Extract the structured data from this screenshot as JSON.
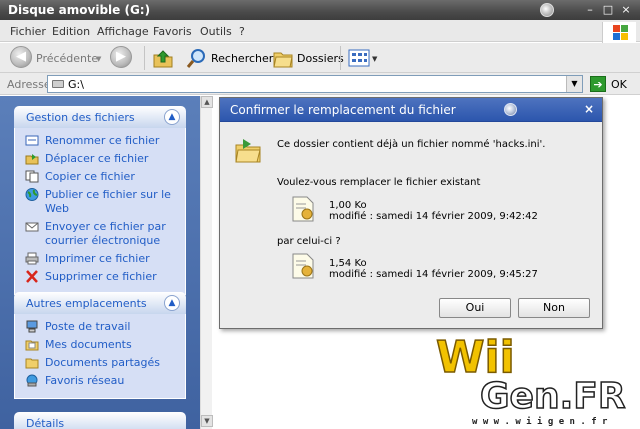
{
  "window": {
    "title": "Disque amovible (G:)"
  },
  "menu": [
    "Fichier",
    "Edition",
    "Affichage",
    "Favoris",
    "Outils",
    "?"
  ],
  "toolbar": {
    "back_label": "Précédente",
    "search_label": "Rechercher",
    "folders_label": "Dossiers"
  },
  "address": {
    "label": "Adresse",
    "value": "G:\\",
    "go_label": "OK"
  },
  "panels": {
    "file_tasks": {
      "title": "Gestion des fichiers",
      "items": [
        "Renommer ce fichier",
        "Déplacer ce fichier",
        "Copier ce fichier",
        "Publier ce fichier sur le Web",
        "Envoyer ce fichier par courrier électronique",
        "Imprimer ce fichier",
        "Supprimer ce fichier"
      ]
    },
    "other_places": {
      "title": "Autres emplacements",
      "items": [
        "Poste de travail",
        "Mes documents",
        "Documents partagés",
        "Favoris réseau"
      ]
    },
    "details": {
      "title": "Détails"
    }
  },
  "dialog": {
    "title": "Confirmer le remplacement du fichier",
    "message": "Ce dossier contient déjà un fichier nommé 'hacks.ini'.",
    "question": "Voulez-vous remplacer le fichier existant",
    "existing": {
      "size": "1,00 Ko",
      "modified": "modifié : samedi 14 février 2009, 9:42:42"
    },
    "by_label": "par celui-ci ?",
    "new": {
      "size": "1,54 Ko",
      "modified": "modifié : samedi 14 février 2009, 9:45:27"
    },
    "yes_label": "Oui",
    "no_label": "Non"
  },
  "watermark": {
    "brand": "WiiGen.FR",
    "url": "w w w . w i i g e n . f r"
  },
  "colors": {
    "task_link": "#215dc6",
    "pane_blue": "#4a6fad",
    "dialog_title": "#3a62b6",
    "go_green": "#2e9a2e",
    "watermark_yellow": "#f2c200"
  }
}
